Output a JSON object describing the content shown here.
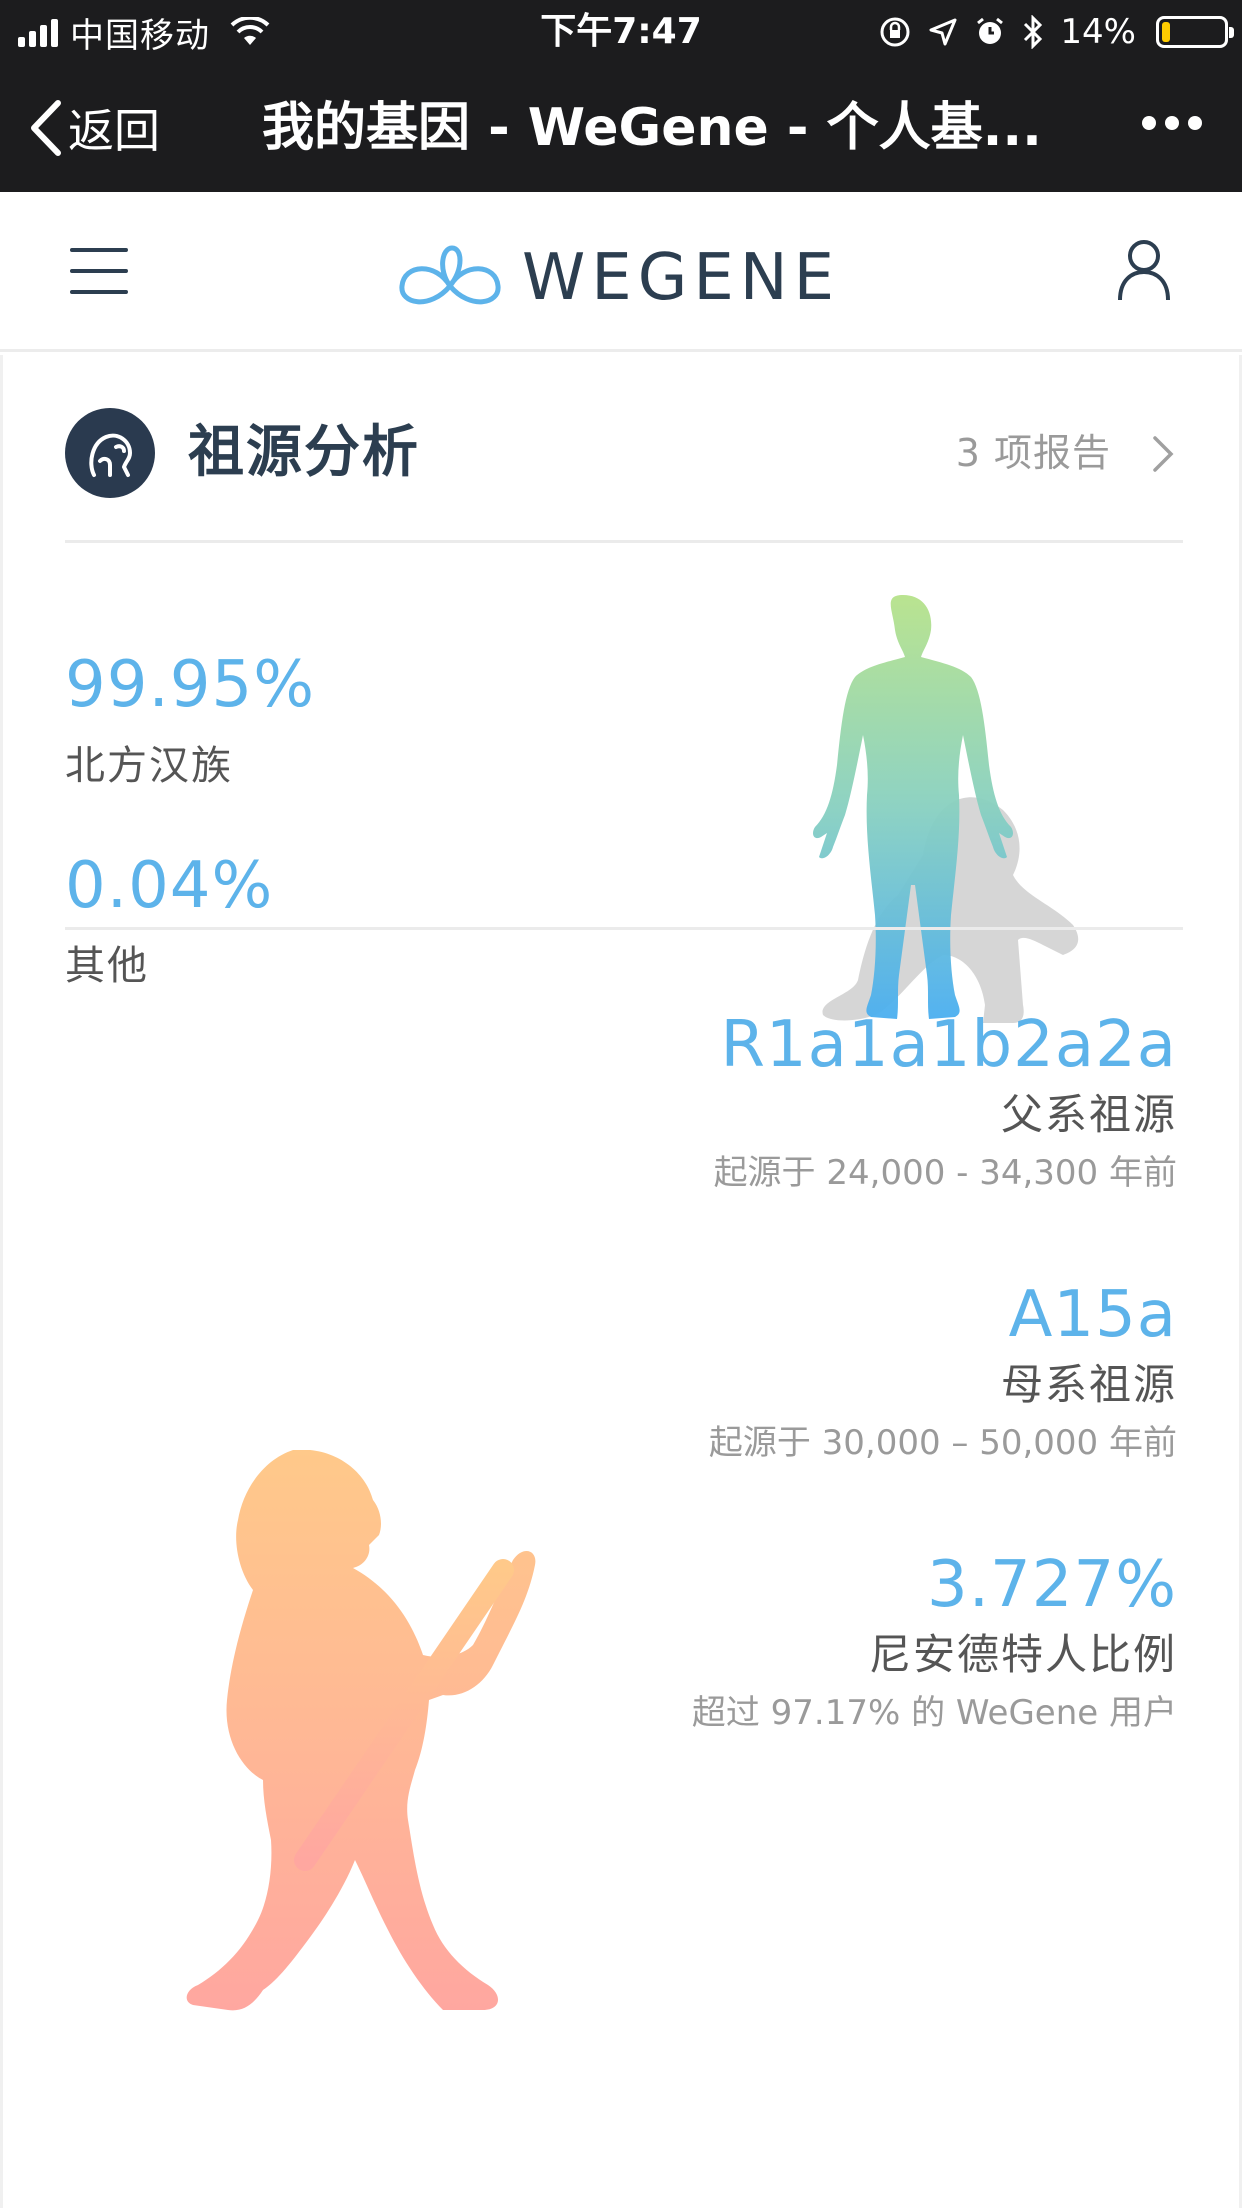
{
  "status_bar": {
    "carrier": "中国移动",
    "time": "下午7:47",
    "battery": "14%",
    "battery_level": 0.14
  },
  "nav": {
    "back_label": "返回",
    "title": "我的基因 - WeGene - 个人基..."
  },
  "site_header": {
    "logo_text": "WEGENE"
  },
  "ancestry_section": {
    "title": "祖源分析",
    "report_count": "3 项报告",
    "composition": [
      {
        "percent": "99.95%",
        "name": "北方汉族"
      },
      {
        "percent": "0.04%",
        "name": "其他"
      }
    ]
  },
  "haplogroups": [
    {
      "value": "R1a1a1b2a2a",
      "label": "父系祖源",
      "note": "起源于 24,000 - 34,300 年前"
    },
    {
      "value": "A15a",
      "label": "母系祖源",
      "note": "起源于 30,000 – 50,000 年前"
    },
    {
      "value": "3.727%",
      "label": "尼安德特人比例",
      "note": "超过 97.17% 的 WeGene 用户"
    }
  ],
  "colors": {
    "accent": "#5db3ea",
    "dark": "#2c3e50",
    "human_gradient_top": "#b6e28a",
    "human_gradient_bottom": "#4aaef0",
    "caveman_gradient_top": "#ffc98a",
    "caveman_gradient_bottom": "#ffa7a0"
  },
  "icons": [
    "signal-icon",
    "wifi-icon",
    "rotation-lock-icon",
    "location-icon",
    "alarm-icon",
    "bluetooth-icon",
    "battery-icon",
    "back-chevron-icon",
    "more-icon",
    "menu-icon",
    "logo-icon",
    "user-icon",
    "gorilla-icon",
    "chevron-right-icon"
  ]
}
